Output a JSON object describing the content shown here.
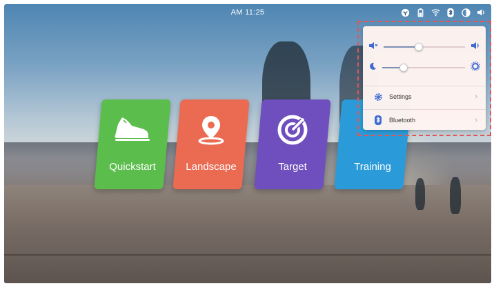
{
  "status_bar": {
    "time": "AM 11:25",
    "icons": [
      "network-icon",
      "battery-icon",
      "wifi-icon",
      "bluetooth-icon",
      "brightness-icon",
      "volume-icon"
    ]
  },
  "tiles": [
    {
      "label": "Quickstart",
      "icon": "shoe-icon",
      "color": "#5bbd4b"
    },
    {
      "label": "Landscape",
      "icon": "location-pin-icon",
      "color": "#ea6b52"
    },
    {
      "label": "Target",
      "icon": "target-icon",
      "color": "#6e4fbd"
    },
    {
      "label": "Training",
      "icon": "training-icon",
      "color": "#2a9bd8"
    }
  ],
  "quick_panel": {
    "volume_level": 0.42,
    "brightness_level": 0.25,
    "settings_label": "Settings",
    "bluetooth_label": "Bluetooth",
    "accent": "#3f6ad1"
  }
}
